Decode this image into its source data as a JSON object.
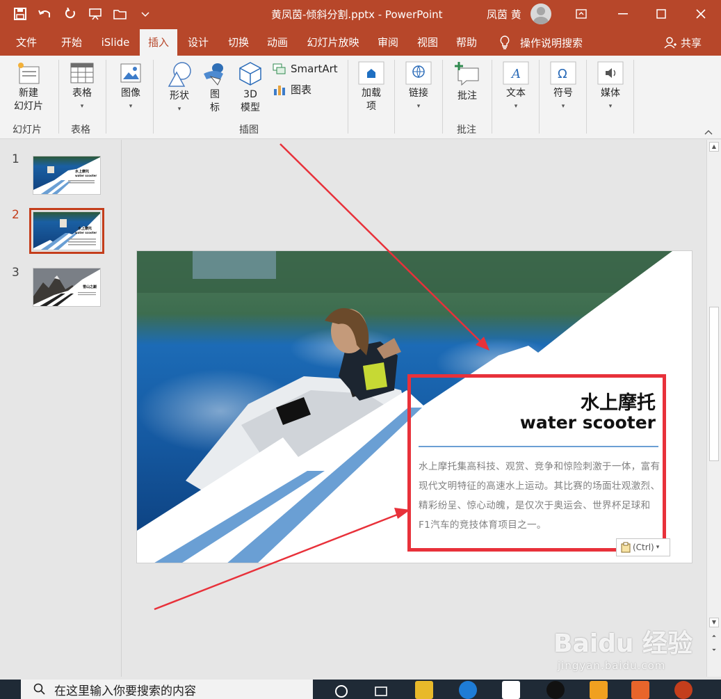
{
  "window": {
    "doc_title": "黄凤茵-倾斜分割.pptx  -  PowerPoint",
    "user_name": "凤茵 黄"
  },
  "tabs": [
    "文件",
    "开始",
    "iSlide",
    "插入",
    "设计",
    "切换",
    "动画",
    "幻灯片放映",
    "审阅",
    "视图",
    "帮助"
  ],
  "active_tab": "插入",
  "tell_me": "操作说明搜索",
  "share": "共享",
  "ribbon": {
    "new_slide": "新建\n幻灯片",
    "table": "表格",
    "image": "图像",
    "shapes": "形状",
    "icons": "图\n标",
    "model3d": "3D\n模型",
    "smartart": "SmartArt",
    "chart": "图表",
    "addins": "加载\n项",
    "link": "链接",
    "comment": "批注",
    "text": "文本",
    "symbol": "符号",
    "media": "媒体",
    "groups": {
      "slides": "幻灯片",
      "tables": "表格",
      "illustrations": "插图",
      "comments": "批注"
    }
  },
  "thumbnails": [
    {
      "number": "1",
      "title": "水上摩托",
      "subtitle": "water scooter"
    },
    {
      "number": "2",
      "title": "水上摩托",
      "subtitle": "water scooter"
    },
    {
      "number": "3",
      "title": "雪山之巅",
      "subtitle": ""
    }
  ],
  "selected_slide": "2",
  "slide": {
    "title_cn": "水上摩托",
    "title_en": "water scooter",
    "body": "水上摩托集高科技、观赏、竞争和惊险刺激于一体，富有现代文明特征的高速水上运动。其比赛的场面壮观激烈、精彩纷呈、惊心动魄，是仅次于奥运会、世界杯足球和F1汽车的竞技体育项目之一。",
    "paste_label": "(Ctrl)"
  },
  "taskbar": {
    "search_placeholder": "在这里输入你要搜索的内容"
  },
  "watermark": {
    "brand": "Baidu 经验",
    "url": "jingyan.baidu.com"
  },
  "colors": {
    "brand": "#b7472a",
    "accent_blue": "#6a9fd4",
    "annotation_red": "#e8313a"
  }
}
